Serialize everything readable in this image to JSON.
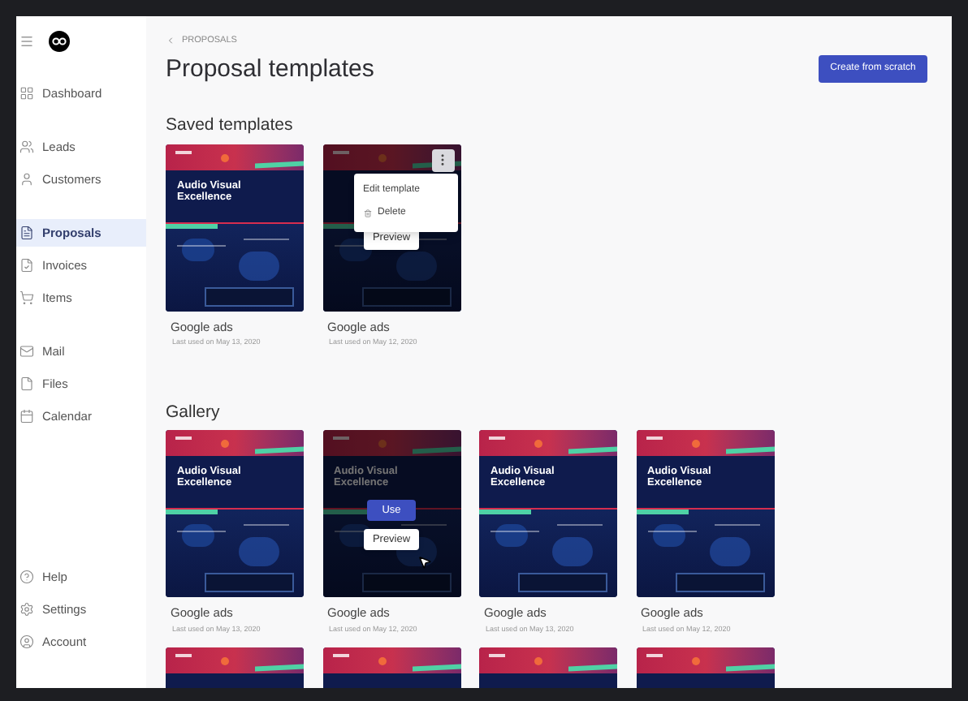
{
  "sidebar": {
    "groups": [
      {
        "items": [
          {
            "label": "Dashboard",
            "selected": false
          }
        ]
      },
      {
        "items": [
          {
            "label": "Leads",
            "selected": false
          },
          {
            "label": "Customers",
            "selected": false
          }
        ]
      },
      {
        "items": [
          {
            "label": "Proposals",
            "selected": true
          },
          {
            "label": "Invoices",
            "selected": false
          },
          {
            "label": "Items",
            "selected": false
          }
        ]
      },
      {
        "items": [
          {
            "label": "Mail",
            "selected": false
          },
          {
            "label": "Files",
            "selected": false
          },
          {
            "label": "Calendar",
            "selected": false
          }
        ]
      },
      {
        "items": [
          {
            "label": "Help",
            "selected": false
          },
          {
            "label": "Settings",
            "selected": false
          },
          {
            "label": "Account",
            "selected": false
          }
        ]
      }
    ]
  },
  "breadcrumb": {
    "label": "PROPOSALS"
  },
  "title": "Proposal templates",
  "primary_button": "Create from scratch",
  "sections": [
    {
      "heading": "Saved templates",
      "cards": [
        {
          "name": "Google ads",
          "last_used": "Last used on May 13, 2020",
          "thumbnail_title": "Audio Visual Excellence",
          "hovered": false
        },
        {
          "name": "Google ads",
          "last_used": "Last used on May 12, 2020",
          "hovered": true,
          "menu": [
            {
              "label": "Edit template",
              "kind": "edit"
            },
            {
              "label": "Delete",
              "kind": "delete"
            }
          ],
          "buttons": [
            {
              "label": "Preview",
              "kind": "secondary"
            }
          ]
        }
      ]
    },
    {
      "heading": "Gallery",
      "cards": [
        {
          "name": "Google ads",
          "last_used": "Last used on May 13, 2020",
          "thumbnail_title": "Audio Visual Excellence",
          "hovered": false
        },
        {
          "name": "Google ads",
          "last_used": "Last used on May 12, 2020",
          "thumbnail_title": "Audio Visual Excellence",
          "hovered": true,
          "pointer": true,
          "buttons": [
            {
              "label": "Use",
              "kind": "primary"
            },
            {
              "label": "Preview",
              "kind": "secondary"
            }
          ]
        },
        {
          "name": "Google ads",
          "last_used": "Last used on May 13, 2020",
          "thumbnail_title": "Audio Visual Excellence",
          "hovered": false
        },
        {
          "name": "Google ads",
          "last_used": "Last used on May 12, 2020",
          "thumbnail_title": "Audio Visual Excellence",
          "hovered": false
        },
        {
          "hovered": false
        },
        {
          "hovered": false
        },
        {
          "hovered": false
        },
        {
          "hovered": false
        }
      ]
    }
  ]
}
